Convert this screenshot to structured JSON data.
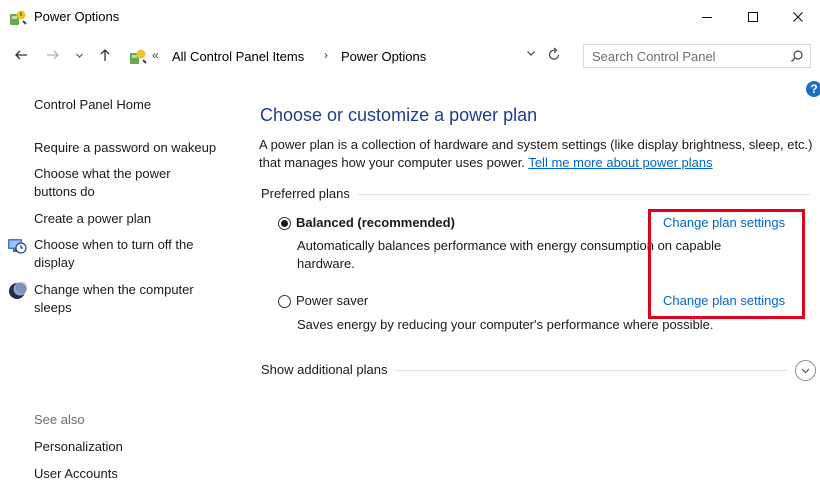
{
  "window": {
    "title": "Power Options"
  },
  "address_bar": {
    "crumb_overflow": "«",
    "crumbs": [
      "All Control Panel Items",
      "Power Options"
    ],
    "separator": "›"
  },
  "search": {
    "placeholder": "Search Control Panel"
  },
  "help": {
    "label": "?"
  },
  "sidebar": {
    "home": "Control Panel Home",
    "items": [
      {
        "label": "Require a password on wakeup",
        "icon": "none"
      },
      {
        "label": "Choose what the power buttons do",
        "icon": "none"
      },
      {
        "label": "Create a power plan",
        "icon": "none"
      },
      {
        "label": "Choose when to turn off the display",
        "icon": "display-clock-icon"
      },
      {
        "label": "Change when the computer sleeps",
        "icon": "moon-icon"
      }
    ],
    "see_also": {
      "title": "See also",
      "items": [
        "Personalization",
        "User Accounts"
      ]
    }
  },
  "main": {
    "title": "Choose or customize a power plan",
    "description": "A power plan is a collection of hardware and system settings (like display brightness, sleep, etc.) that manages how your computer uses power.",
    "learn_more": "Tell me more about power plans",
    "preferred_plans_label": "Preferred plans",
    "plans": [
      {
        "name": "Balanced (recommended)",
        "selected": true,
        "description": "Automatically balances performance with energy consumption on capable hardware.",
        "link": "Change plan settings"
      },
      {
        "name": "Power saver",
        "selected": false,
        "description": "Saves energy by reducing your computer's performance where possible.",
        "link": "Change plan settings"
      }
    ],
    "additional_plans_label": "Show additional plans"
  },
  "colors": {
    "heading": "#1e3d8f",
    "link": "#0066cc",
    "highlight": "#e0001b"
  }
}
